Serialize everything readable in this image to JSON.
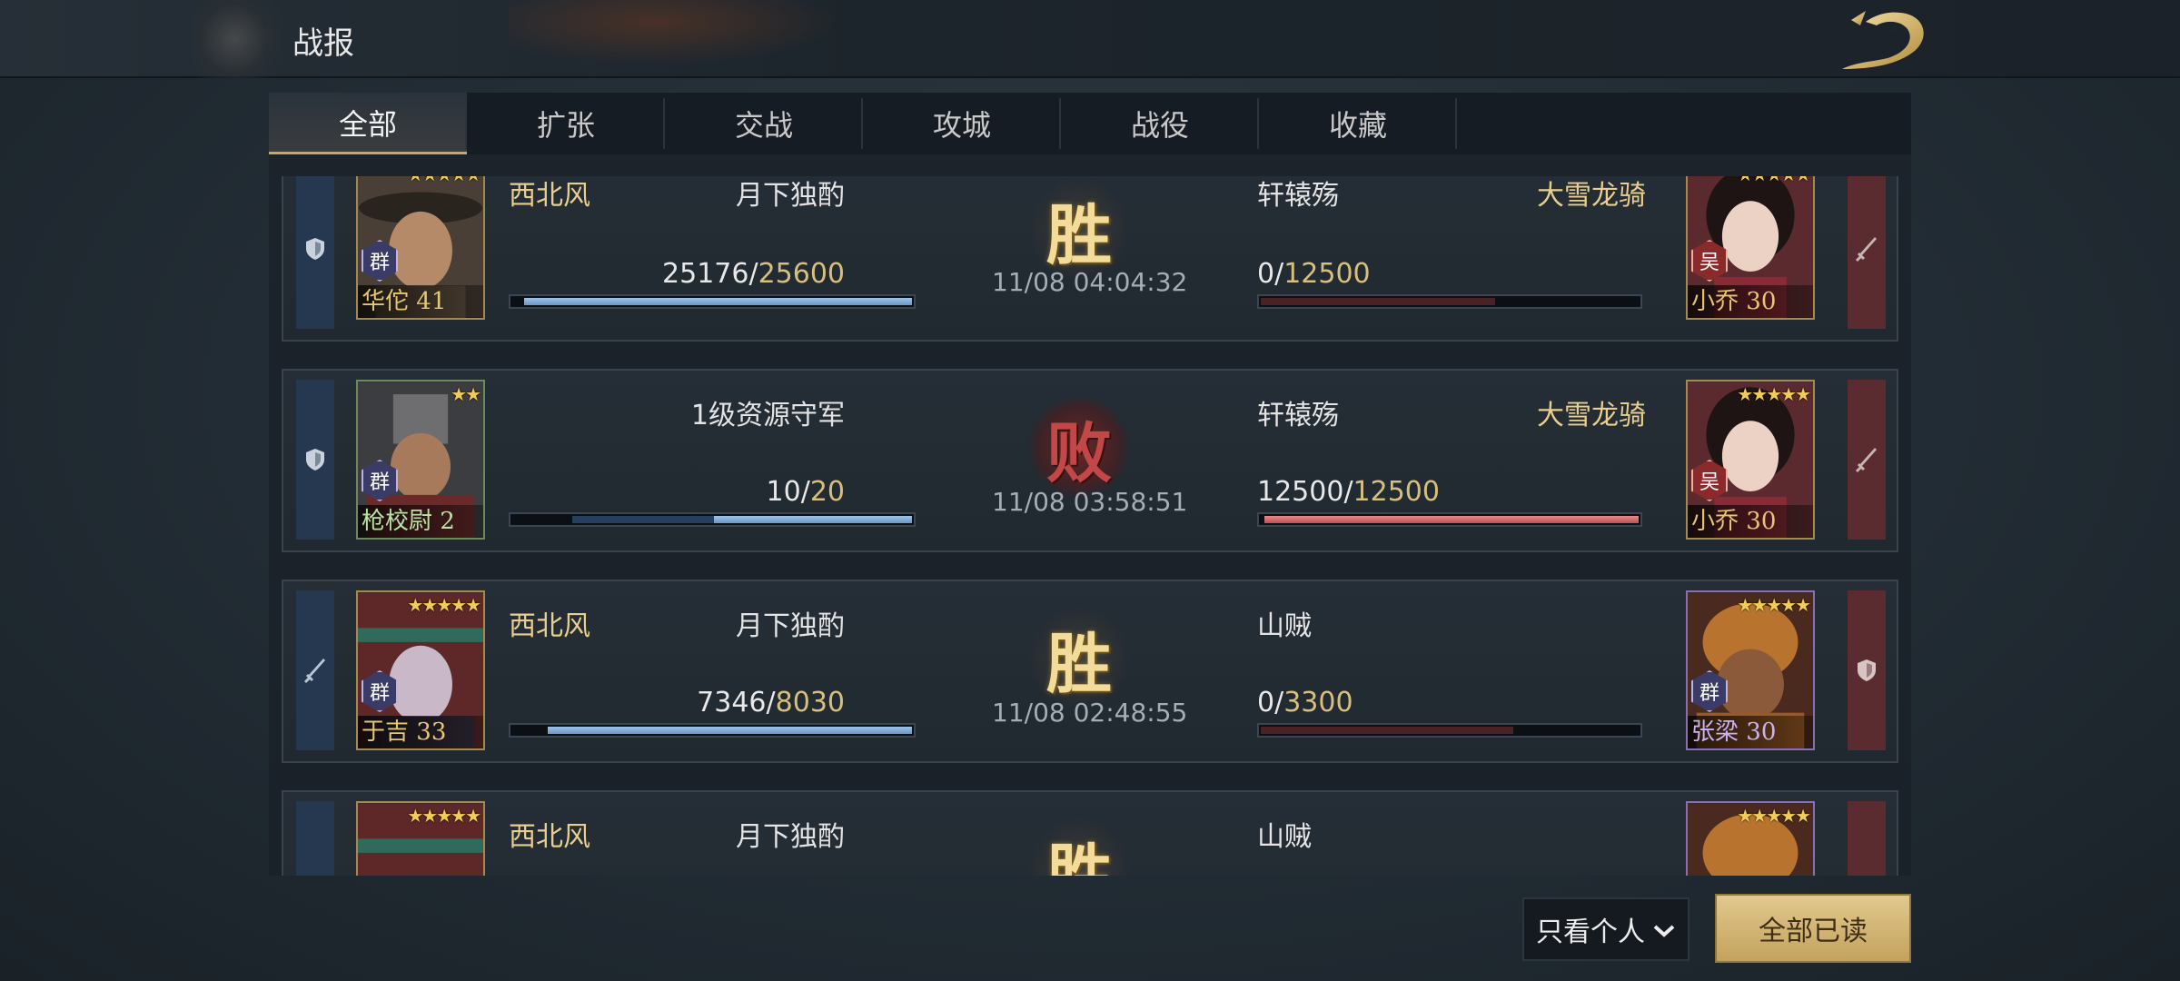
{
  "header": {
    "title": "战报"
  },
  "tabs": [
    {
      "label": "全部",
      "active": true
    },
    {
      "label": "扩张"
    },
    {
      "label": "交战"
    },
    {
      "label": "攻城"
    },
    {
      "label": "战役"
    },
    {
      "label": "收藏"
    }
  ],
  "reports": [
    {
      "left_role": "shield-icon",
      "right_role": "sword-icon",
      "left": {
        "player": "西北风",
        "alliance": "",
        "commander": "月下独酌",
        "hero": "华佗",
        "level": "41",
        "faction": "群",
        "stars": "★★★★★",
        "troops_cur": "25176",
        "troops_max": "25600",
        "fill": 0.98
      },
      "result": "胜",
      "time": "11/08 04:04:32",
      "right": {
        "player": "轩辕殇",
        "alliance": "大雪龙骑",
        "hero": "小乔",
        "level": "30",
        "faction": "吴",
        "stars": "★★★★★",
        "troops_cur": "0",
        "troops_max": "12500",
        "fill": 0.0
      }
    },
    {
      "left_role": "shield-icon",
      "right_role": "sword-icon",
      "left": {
        "player": "",
        "alliance": "",
        "commander": "1级资源守军",
        "hero": "枪校尉",
        "level": "2",
        "faction": "群",
        "stars": "★★",
        "troops_cur": "10",
        "troops_max": "20",
        "fill": 0.5
      },
      "result": "败",
      "time": "11/08 03:58:51",
      "right": {
        "player": "轩辕殇",
        "alliance": "大雪龙骑",
        "hero": "小乔",
        "level": "30",
        "faction": "吴",
        "stars": "★★★★★",
        "troops_cur": "12500",
        "troops_max": "12500",
        "fill": 1.0
      }
    },
    {
      "left_role": "sword-icon",
      "right_role": "shield-icon",
      "left": {
        "player": "西北风",
        "alliance": "",
        "commander": "月下独酌",
        "hero": "于吉",
        "level": "33",
        "faction": "群",
        "stars": "★★★★★",
        "troops_cur": "7346",
        "troops_max": "8030",
        "fill": 0.92
      },
      "result": "胜",
      "time": "11/08 02:48:55",
      "right": {
        "player": "山贼",
        "alliance": "",
        "hero": "张梁",
        "level": "30",
        "faction": "群",
        "stars": "★★★★★",
        "troops_cur": "0",
        "troops_max": "3300",
        "fill": 0.0
      }
    },
    {
      "left_role": "sword-icon",
      "right_role": "shield-icon",
      "left": {
        "player": "西北风",
        "alliance": "",
        "commander": "月下独酌",
        "hero": "",
        "level": "",
        "faction": "",
        "stars": "★★★★★"
      },
      "result": "胜",
      "time": "",
      "right": {
        "player": "山贼",
        "alliance": "",
        "hero": "",
        "level": "",
        "faction": "",
        "stars": "★★★★★"
      }
    }
  ],
  "footer": {
    "filter_label": "只看个人",
    "read_all_label": "全部已读"
  },
  "colors": {
    "gold": "#e9cf8d",
    "win": "#f3dc9a",
    "lose": "#c24747",
    "blue_bar": "#7aa6d6",
    "red_bar": "#d06060"
  }
}
